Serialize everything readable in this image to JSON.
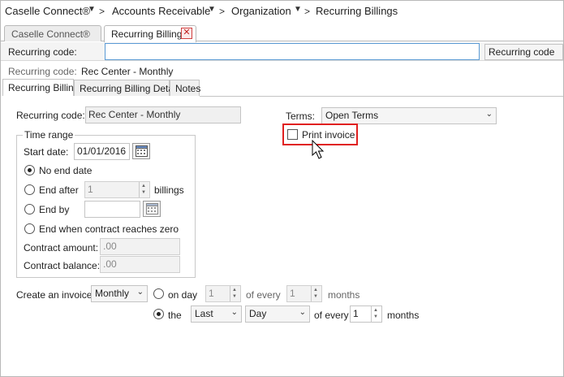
{
  "breadcrumb": {
    "items": [
      "Caselle Connect®",
      "Accounts Receivable",
      "Organization",
      "Recurring Billings"
    ]
  },
  "tabs": [
    {
      "label": "Caselle Connect®"
    },
    {
      "label": "Recurring Billings"
    }
  ],
  "search": {
    "label": "Recurring code:",
    "value": "",
    "field_select": "Recurring code"
  },
  "record": {
    "label": "Recurring code:",
    "value": "Rec Center - Monthly"
  },
  "subtabs": [
    {
      "label": "Recurring Billing"
    },
    {
      "label": "Recurring Billing Detail"
    },
    {
      "label": "Notes"
    }
  ],
  "form": {
    "recurring_code_label": "Recurring code:",
    "recurring_code_value": "Rec Center - Monthly",
    "terms_label": "Terms:",
    "terms_value": "Open Terms",
    "print_invoice_label": "Print invoice",
    "print_invoice_checked": false,
    "time_range": {
      "legend": "Time range",
      "start_date_label": "Start date:",
      "start_date_value": "01/01/2016",
      "no_end_date_label": "No end date",
      "end_after_label": "End after",
      "end_after_value": "1",
      "billings_label": "billings",
      "end_by_label": "End by",
      "end_by_value": "",
      "end_contract_label": "End when contract reaches zero",
      "contract_amount_label": "Contract amount:",
      "contract_amount_value": ".00",
      "contract_balance_label": "Contract balance:",
      "contract_balance_value": ".00"
    },
    "invoice": {
      "create_label": "Create an invoice",
      "frequency": "Monthly",
      "on_day_label": "on day",
      "on_day_value": "1",
      "of_every_label": "of every",
      "of_every_value": "1",
      "months_label": "months",
      "the_label": "the",
      "ordinal": "Last",
      "day_type": "Day",
      "of_every_label_2": "of every",
      "of_every_value_2": "1",
      "months_label_2": "months"
    }
  },
  "colors": {
    "highlight": "#e02020",
    "focus_border": "#5b9bd5"
  }
}
